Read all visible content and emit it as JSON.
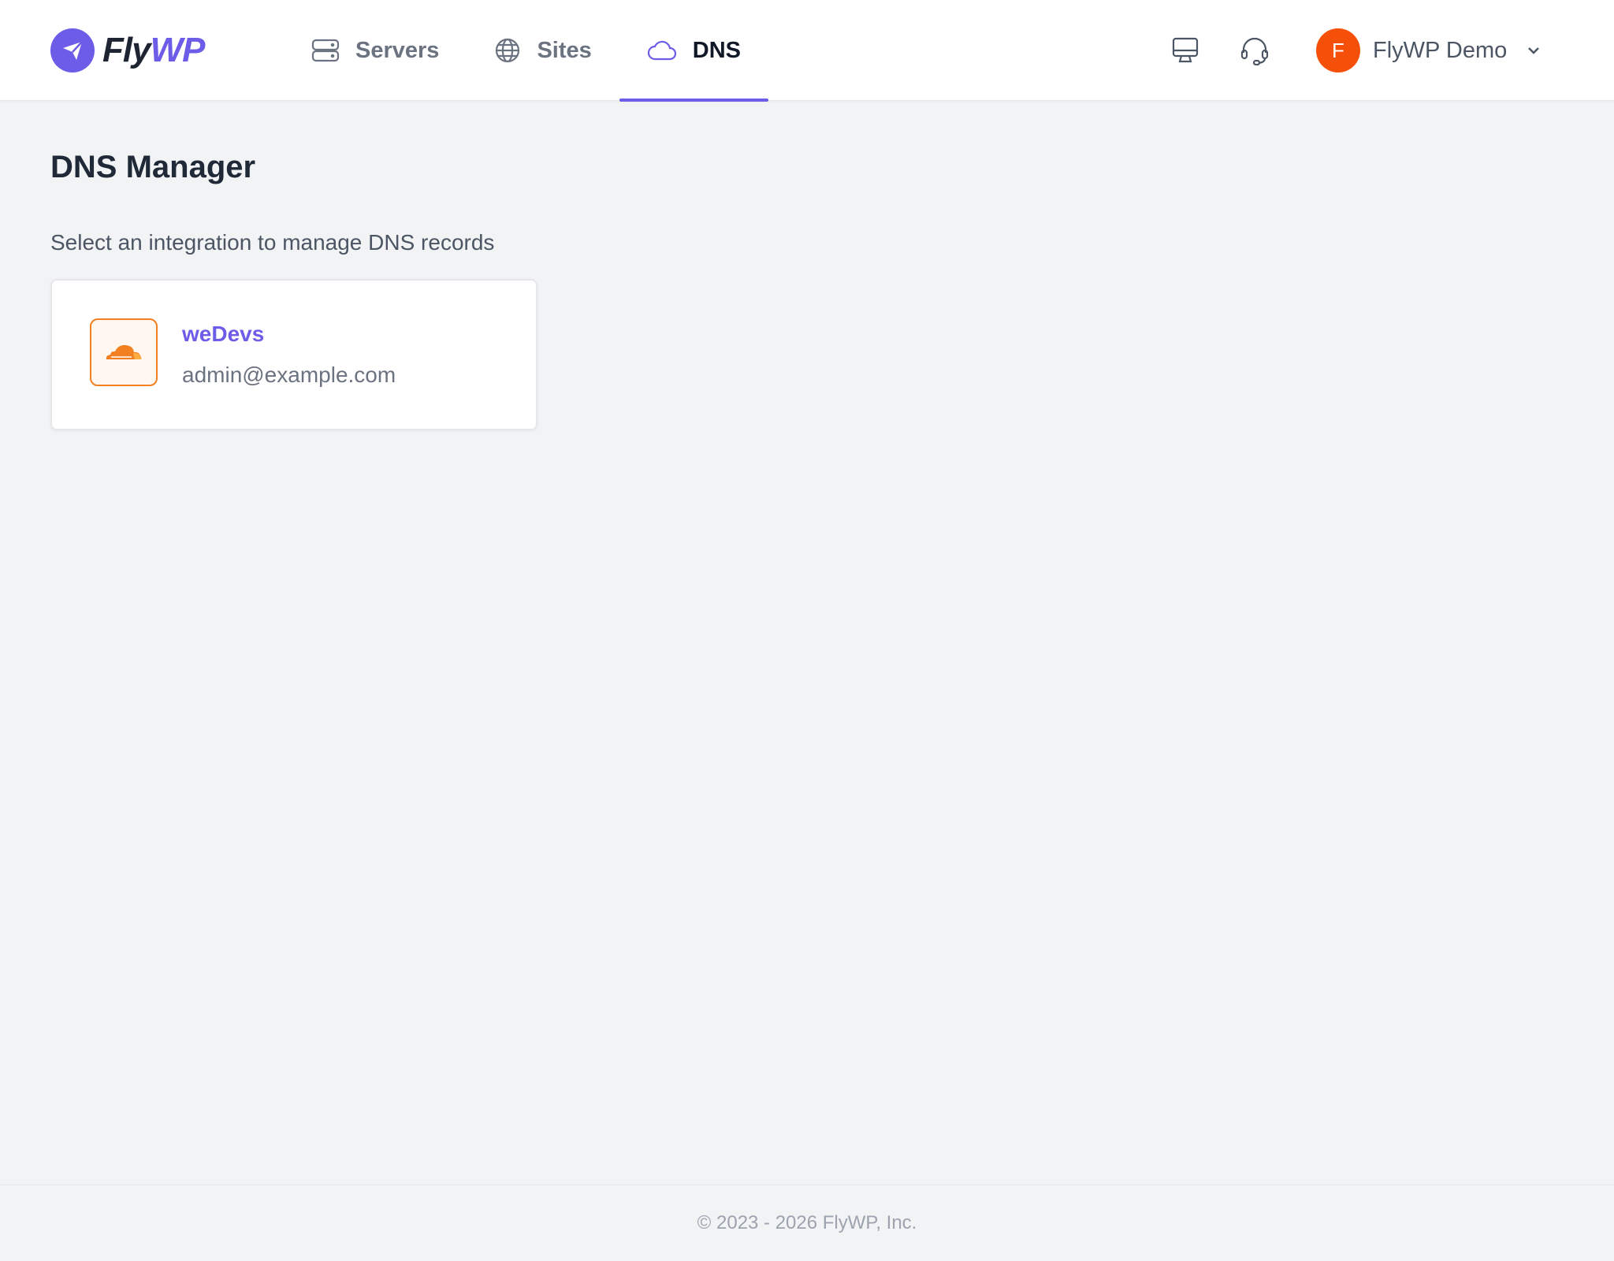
{
  "brand": {
    "name_part1": "Fly",
    "name_part2": "WP",
    "accent_color": "#6c5ce7"
  },
  "nav": {
    "items": [
      {
        "label": "Servers",
        "icon": "server-icon",
        "active": false
      },
      {
        "label": "Sites",
        "icon": "globe-icon",
        "active": false
      },
      {
        "label": "DNS",
        "icon": "cloud-icon",
        "active": true
      }
    ]
  },
  "header_actions": {
    "monitor_icon": "monitor-icon",
    "support_icon": "headset-icon"
  },
  "user": {
    "avatar_initial": "F",
    "name": "FlyWP Demo",
    "avatar_color": "#f45009"
  },
  "page": {
    "title": "DNS Manager",
    "subtitle": "Select an integration to manage DNS records"
  },
  "integrations": [
    {
      "name": "weDevs",
      "email": "admin@example.com",
      "icon": "cloudflare-icon",
      "brand_color": "#f38020"
    }
  ],
  "footer": {
    "copyright": "© 2023 - 2026 FlyWP, Inc."
  }
}
